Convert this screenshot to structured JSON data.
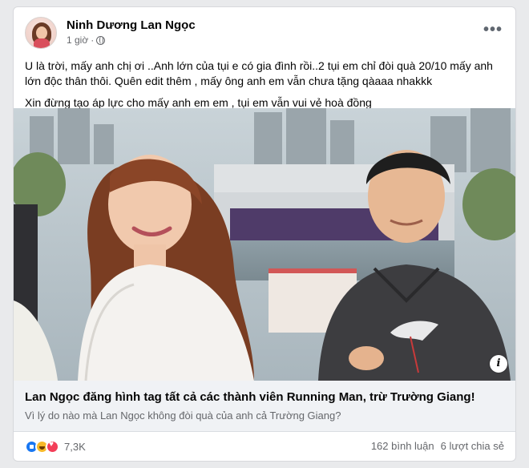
{
  "post": {
    "author": "Ninh Dương Lan Ngọc",
    "time": "1 giờ",
    "privacy_icon": "globe-icon",
    "more_icon": "more-horizontal-icon",
    "more_label": "•••",
    "paragraphs": [
      "U là trời, mấy anh chị ơi ..Anh lớn của tụi e có gia đình rồi..2 tụi em chỉ đòi quà 20/10 mấy anh lớn độc thân thôi. Quên edit thêm , mấy ông anh em vẫn chưa tặng qàaaa nhakkk",
      "Xin đừng tạo áp lực cho mấy anh em em , tụi em vẫn vui vẻ hoà đồng"
    ]
  },
  "link_preview": {
    "info_label": "i",
    "title": "Lan Ngọc đăng hình tag tất cả các thành viên Running Man, trừ Trường Giang!",
    "description": "Vì lý do nào mà Lan Ngọc không đòi quà của anh cả Trường Giang?"
  },
  "footer": {
    "reaction_icons": [
      "like-icon",
      "haha-icon",
      "love-icon"
    ],
    "reaction_count": "7,3K",
    "comments": "162 bình luận",
    "shares": "6 lượt chia sẻ"
  },
  "colors": {
    "page_bg": "#e9eaec",
    "card_bg": "#ffffff",
    "link_bg": "#f0f2f5",
    "secondary_text": "#65676b",
    "like_blue": "#1877f2",
    "love_red": "#f33e58",
    "haha_yellow": "#f7b928"
  }
}
